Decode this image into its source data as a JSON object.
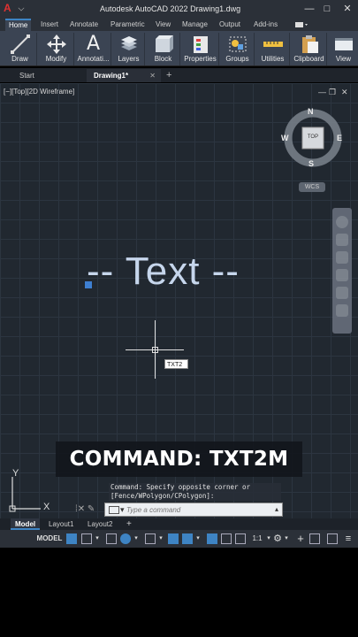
{
  "title": {
    "text": "Autodesk AutoCAD 2022    Drawing1.dwg",
    "window_buttons": [
      "—",
      "□",
      "✕"
    ]
  },
  "ribbon_tabs": [
    "Home",
    "Insert",
    "Annotate",
    "Parametric",
    "View",
    "Manage",
    "Output",
    "Add-ins"
  ],
  "ribbon_buttons": [
    "Draw",
    "Modify",
    "Annotati...",
    "Layers",
    "Block",
    "Properties",
    "Groups",
    "Utilities",
    "Clipboard",
    "View"
  ],
  "doc_tabs": {
    "start": "Start",
    "active": "Drawing1*",
    "close": "✕",
    "add": "+"
  },
  "viewport": {
    "label": "[−][Top][2D Wireframe]",
    "controls": [
      "—",
      "❐",
      "✕"
    ],
    "viewcube": {
      "n": "N",
      "s": "S",
      "e": "E",
      "w": "W",
      "face": "TOP"
    },
    "wcs": "WCS",
    "drawn_text": "-- Text --",
    "dynamic_input": "TXT2",
    "caption": "COMMAND: TXT2M",
    "ucs": {
      "x": "X",
      "y": "Y"
    }
  },
  "command": {
    "history_line1": "Command: Specify opposite corner or",
    "history_line2": "[Fence/WPolygon/CPolygon]:",
    "placeholder": "Type a command"
  },
  "layout_tabs": [
    "Model",
    "Layout1",
    "Layout2",
    "+"
  ],
  "status": {
    "model": "MODEL",
    "scale": "1:1"
  },
  "colors": {
    "accent": "#3e84c4",
    "canvas": "#212830",
    "text_object": "#c6d6ec"
  }
}
